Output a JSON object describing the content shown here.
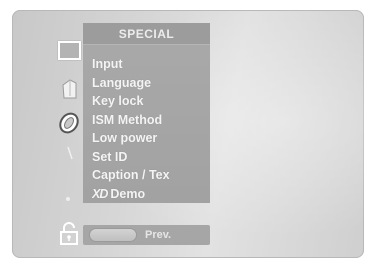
{
  "menu": {
    "title": "SPECIAL",
    "items": [
      {
        "label": "Input"
      },
      {
        "label": "Language"
      },
      {
        "label": "Key lock"
      },
      {
        "label": "ISM Method"
      },
      {
        "label": "Low power"
      },
      {
        "label": "Set ID"
      },
      {
        "label": "Caption / Tex"
      },
      {
        "label_prefix": "XD",
        "label": "Demo"
      }
    ]
  },
  "footer": {
    "prev_label": "Prev."
  },
  "sidebar": {
    "icons": [
      "screen-icon",
      "audio-icon",
      "special-icon",
      "time-icon",
      "dot-icon",
      "lock-icon"
    ]
  },
  "colors": {
    "panel": "#a9a9a9",
    "frame": "#d6d6d6",
    "text": "#f4f4f4"
  }
}
